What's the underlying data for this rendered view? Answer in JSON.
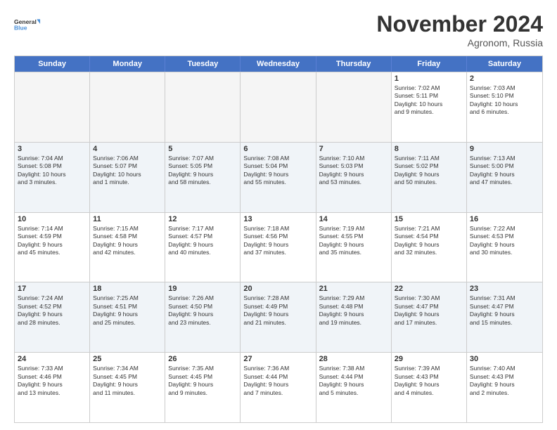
{
  "logo": {
    "line1": "General",
    "line2": "Blue"
  },
  "title": "November 2024",
  "location": "Agronom, Russia",
  "days_of_week": [
    "Sunday",
    "Monday",
    "Tuesday",
    "Wednesday",
    "Thursday",
    "Friday",
    "Saturday"
  ],
  "weeks": [
    {
      "alt": false,
      "cells": [
        {
          "empty": true,
          "day": "",
          "detail": ""
        },
        {
          "empty": true,
          "day": "",
          "detail": ""
        },
        {
          "empty": true,
          "day": "",
          "detail": ""
        },
        {
          "empty": true,
          "day": "",
          "detail": ""
        },
        {
          "empty": true,
          "day": "",
          "detail": ""
        },
        {
          "empty": false,
          "day": "1",
          "detail": "Sunrise: 7:02 AM\nSunset: 5:11 PM\nDaylight: 10 hours\nand 9 minutes."
        },
        {
          "empty": false,
          "day": "2",
          "detail": "Sunrise: 7:03 AM\nSunset: 5:10 PM\nDaylight: 10 hours\nand 6 minutes."
        }
      ]
    },
    {
      "alt": true,
      "cells": [
        {
          "empty": false,
          "day": "3",
          "detail": "Sunrise: 7:04 AM\nSunset: 5:08 PM\nDaylight: 10 hours\nand 3 minutes."
        },
        {
          "empty": false,
          "day": "4",
          "detail": "Sunrise: 7:06 AM\nSunset: 5:07 PM\nDaylight: 10 hours\nand 1 minute."
        },
        {
          "empty": false,
          "day": "5",
          "detail": "Sunrise: 7:07 AM\nSunset: 5:05 PM\nDaylight: 9 hours\nand 58 minutes."
        },
        {
          "empty": false,
          "day": "6",
          "detail": "Sunrise: 7:08 AM\nSunset: 5:04 PM\nDaylight: 9 hours\nand 55 minutes."
        },
        {
          "empty": false,
          "day": "7",
          "detail": "Sunrise: 7:10 AM\nSunset: 5:03 PM\nDaylight: 9 hours\nand 53 minutes."
        },
        {
          "empty": false,
          "day": "8",
          "detail": "Sunrise: 7:11 AM\nSunset: 5:02 PM\nDaylight: 9 hours\nand 50 minutes."
        },
        {
          "empty": false,
          "day": "9",
          "detail": "Sunrise: 7:13 AM\nSunset: 5:00 PM\nDaylight: 9 hours\nand 47 minutes."
        }
      ]
    },
    {
      "alt": false,
      "cells": [
        {
          "empty": false,
          "day": "10",
          "detail": "Sunrise: 7:14 AM\nSunset: 4:59 PM\nDaylight: 9 hours\nand 45 minutes."
        },
        {
          "empty": false,
          "day": "11",
          "detail": "Sunrise: 7:15 AM\nSunset: 4:58 PM\nDaylight: 9 hours\nand 42 minutes."
        },
        {
          "empty": false,
          "day": "12",
          "detail": "Sunrise: 7:17 AM\nSunset: 4:57 PM\nDaylight: 9 hours\nand 40 minutes."
        },
        {
          "empty": false,
          "day": "13",
          "detail": "Sunrise: 7:18 AM\nSunset: 4:56 PM\nDaylight: 9 hours\nand 37 minutes."
        },
        {
          "empty": false,
          "day": "14",
          "detail": "Sunrise: 7:19 AM\nSunset: 4:55 PM\nDaylight: 9 hours\nand 35 minutes."
        },
        {
          "empty": false,
          "day": "15",
          "detail": "Sunrise: 7:21 AM\nSunset: 4:54 PM\nDaylight: 9 hours\nand 32 minutes."
        },
        {
          "empty": false,
          "day": "16",
          "detail": "Sunrise: 7:22 AM\nSunset: 4:53 PM\nDaylight: 9 hours\nand 30 minutes."
        }
      ]
    },
    {
      "alt": true,
      "cells": [
        {
          "empty": false,
          "day": "17",
          "detail": "Sunrise: 7:24 AM\nSunset: 4:52 PM\nDaylight: 9 hours\nand 28 minutes."
        },
        {
          "empty": false,
          "day": "18",
          "detail": "Sunrise: 7:25 AM\nSunset: 4:51 PM\nDaylight: 9 hours\nand 25 minutes."
        },
        {
          "empty": false,
          "day": "19",
          "detail": "Sunrise: 7:26 AM\nSunset: 4:50 PM\nDaylight: 9 hours\nand 23 minutes."
        },
        {
          "empty": false,
          "day": "20",
          "detail": "Sunrise: 7:28 AM\nSunset: 4:49 PM\nDaylight: 9 hours\nand 21 minutes."
        },
        {
          "empty": false,
          "day": "21",
          "detail": "Sunrise: 7:29 AM\nSunset: 4:48 PM\nDaylight: 9 hours\nand 19 minutes."
        },
        {
          "empty": false,
          "day": "22",
          "detail": "Sunrise: 7:30 AM\nSunset: 4:47 PM\nDaylight: 9 hours\nand 17 minutes."
        },
        {
          "empty": false,
          "day": "23",
          "detail": "Sunrise: 7:31 AM\nSunset: 4:47 PM\nDaylight: 9 hours\nand 15 minutes."
        }
      ]
    },
    {
      "alt": false,
      "cells": [
        {
          "empty": false,
          "day": "24",
          "detail": "Sunrise: 7:33 AM\nSunset: 4:46 PM\nDaylight: 9 hours\nand 13 minutes."
        },
        {
          "empty": false,
          "day": "25",
          "detail": "Sunrise: 7:34 AM\nSunset: 4:45 PM\nDaylight: 9 hours\nand 11 minutes."
        },
        {
          "empty": false,
          "day": "26",
          "detail": "Sunrise: 7:35 AM\nSunset: 4:45 PM\nDaylight: 9 hours\nand 9 minutes."
        },
        {
          "empty": false,
          "day": "27",
          "detail": "Sunrise: 7:36 AM\nSunset: 4:44 PM\nDaylight: 9 hours\nand 7 minutes."
        },
        {
          "empty": false,
          "day": "28",
          "detail": "Sunrise: 7:38 AM\nSunset: 4:44 PM\nDaylight: 9 hours\nand 5 minutes."
        },
        {
          "empty": false,
          "day": "29",
          "detail": "Sunrise: 7:39 AM\nSunset: 4:43 PM\nDaylight: 9 hours\nand 4 minutes."
        },
        {
          "empty": false,
          "day": "30",
          "detail": "Sunrise: 7:40 AM\nSunset: 4:43 PM\nDaylight: 9 hours\nand 2 minutes."
        }
      ]
    }
  ]
}
